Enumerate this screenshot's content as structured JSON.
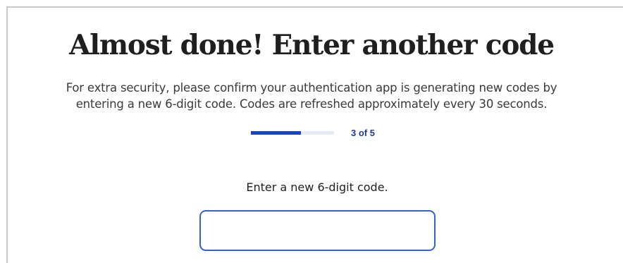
{
  "page": {
    "title": "Almost done! Enter another code",
    "description_line1": "For extra security, please confirm your authentication app is generating new codes by",
    "description_line2": "entering a new 6-digit code. Codes are refreshed approximately every 30 seconds."
  },
  "progress": {
    "label": "3 of 5",
    "current_step": 3,
    "total_steps": 5,
    "fill_fraction": 0.6,
    "fill_color": "#1646c8",
    "track_color": "#e6ebf7"
  },
  "code_form": {
    "label": "Enter a new 6-digit code.",
    "value": "",
    "placeholder": "",
    "border_color": "#2f63d8"
  }
}
